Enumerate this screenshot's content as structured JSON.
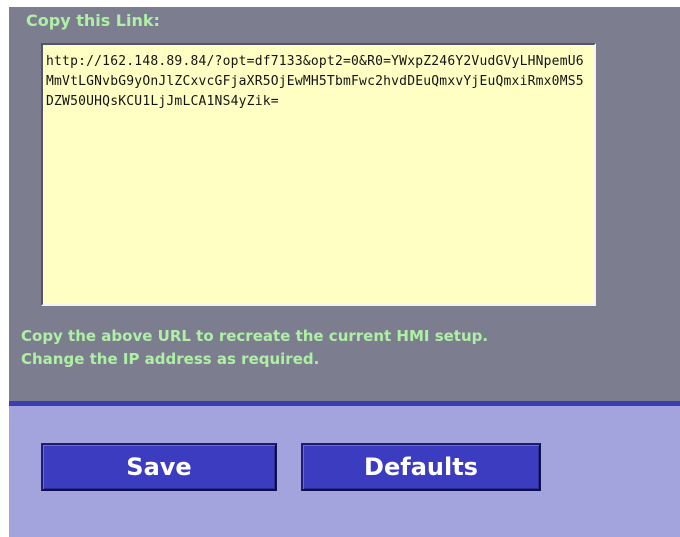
{
  "panel": {
    "title": "Copy this Link:",
    "link_text": "http://162.148.89.84/?opt=df7133&opt2=0&R0=YWxpZ246Y2VudGVyLHNpemU6MmVtLGNvbG9yOnJlZCxvcGFjaXR5OjEwMH5TbmFwc2hvdDEuQmxvYjEuQmxiRmx0MS5DZW50UHQsKCU1LjJmLCA1NS4yZik=",
    "hint_line_1": "Copy the above URL to recreate the current HMI setup.",
    "hint_line_2": "Change the IP address as required."
  },
  "buttons": {
    "save_label": "Save",
    "defaults_label": "Defaults"
  },
  "colors": {
    "panel_background": "#7d7d90",
    "text_green": "#aef0a4",
    "link_box_background": "#ffffc4",
    "divider": "#3c3cb4",
    "footer_background": "#a3a3de",
    "button_background": "#3c3cc0"
  }
}
